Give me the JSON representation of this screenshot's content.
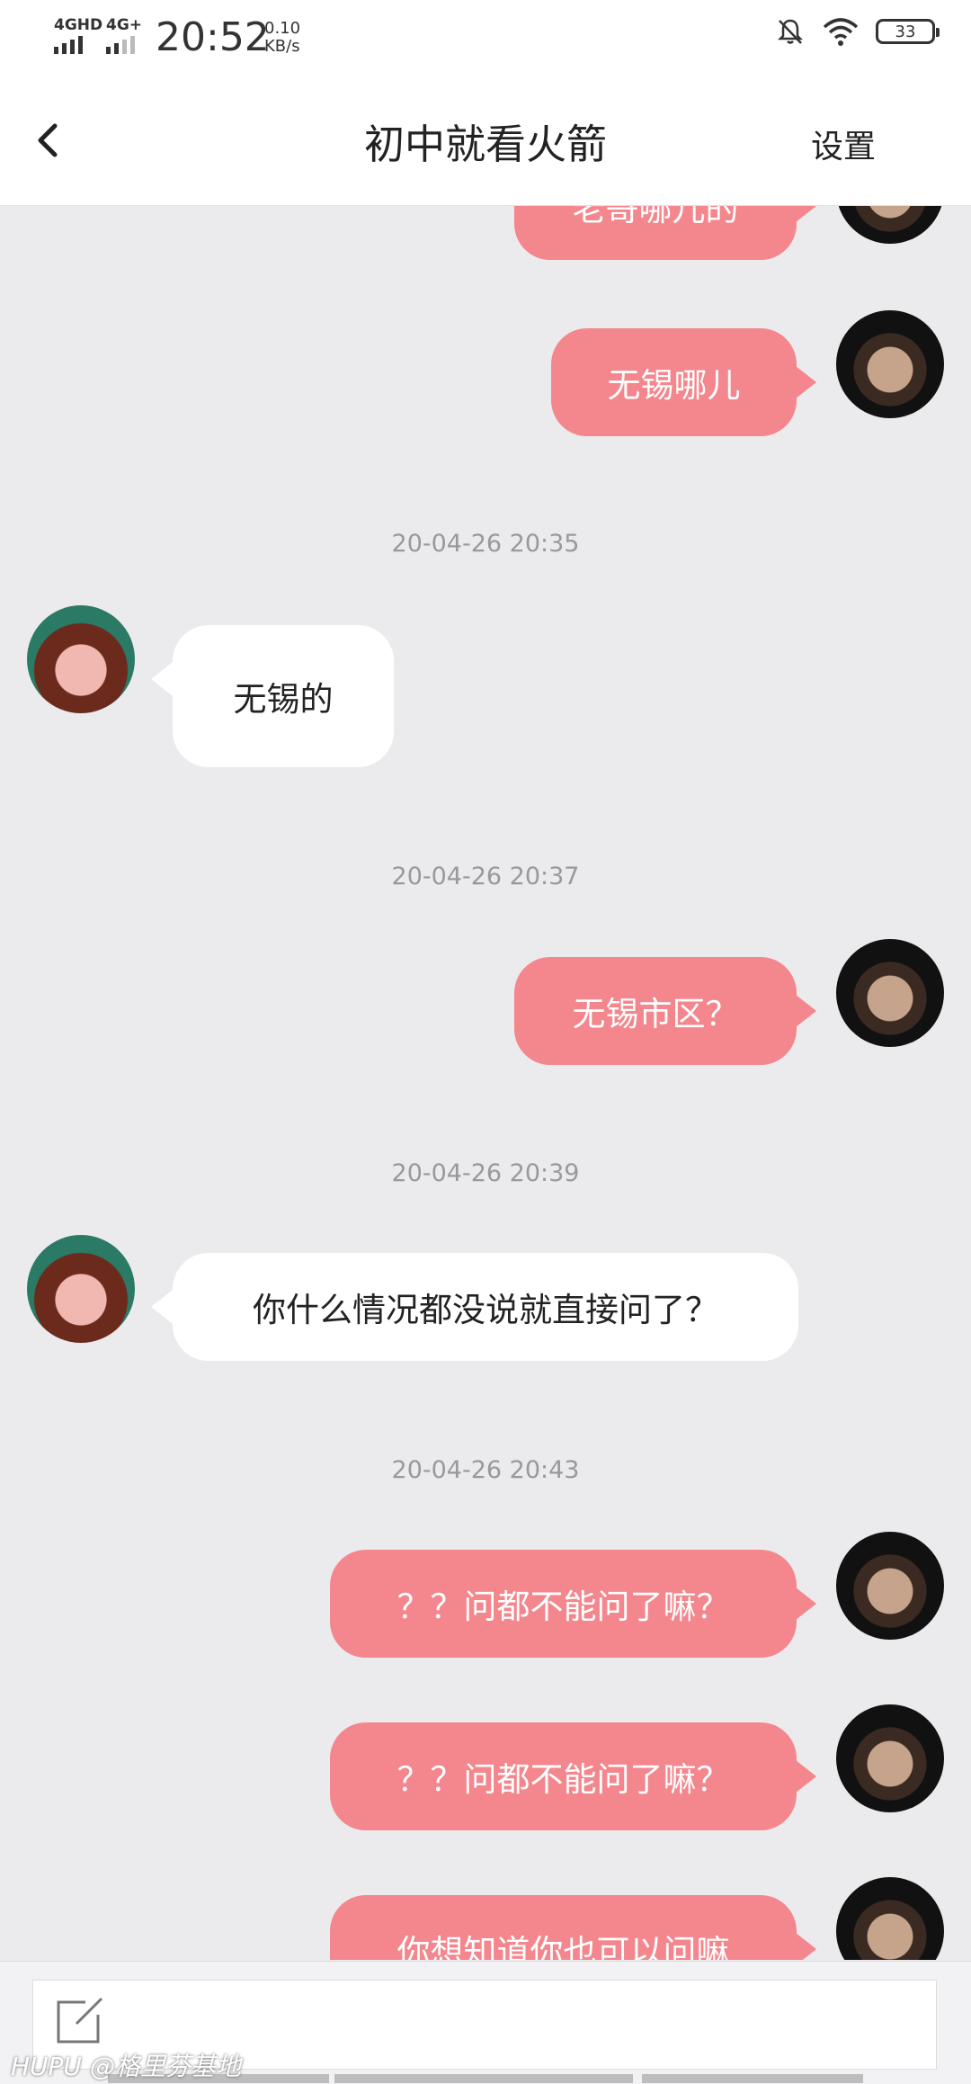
{
  "status_bar": {
    "network1": "4GHD",
    "network2": "4G+",
    "time": "20:52",
    "speed_value": "0.10",
    "speed_unit": "KB/s",
    "battery": "33"
  },
  "header": {
    "title": "初中就看火箭",
    "settings_label": "设置"
  },
  "messages": [
    {
      "type": "out",
      "text": "老哥哪儿的"
    },
    {
      "type": "out",
      "text": "无锡哪儿"
    },
    {
      "type": "time",
      "text": "20-04-26 20:35"
    },
    {
      "type": "in",
      "text": "无锡的"
    },
    {
      "type": "time",
      "text": "20-04-26 20:37"
    },
    {
      "type": "out",
      "text": "无锡市区？"
    },
    {
      "type": "time",
      "text": "20-04-26 20:39"
    },
    {
      "type": "in",
      "text": "你什么情况都没说就直接问了？"
    },
    {
      "type": "time",
      "text": "20-04-26 20:43"
    },
    {
      "type": "out",
      "text": "？？问都不能问了嘛？"
    },
    {
      "type": "out",
      "text": "？？问都不能问了嘛？"
    },
    {
      "type": "out",
      "text": "你想知道你也可以问嘛"
    }
  ],
  "watermark": "HUPU @格里芬基地",
  "colors": {
    "outgoing_bubble": "#f4868d",
    "incoming_bubble": "#ffffff",
    "chat_background": "#ebebed"
  },
  "icons": {
    "back": "chevron-left-icon",
    "compose": "compose-icon",
    "mute": "bell-off-icon",
    "wifi": "wifi-icon"
  }
}
